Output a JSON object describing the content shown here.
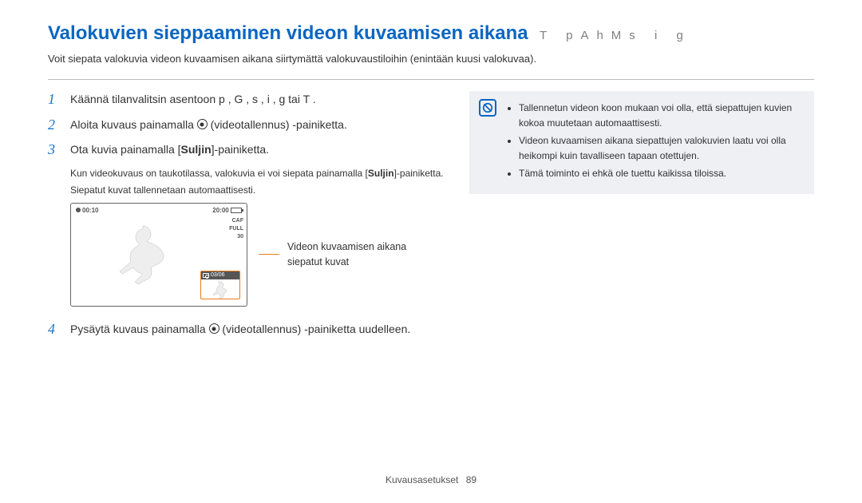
{
  "title": "Valokuvien sieppaaminen videon kuvaamisen aikana",
  "title_suffix": "T  pAhMs  i  g",
  "intro": "Voit siepata valokuvia videon kuvaamisen aikana siirtymättä valokuvaustiloihin (enintään kuusi valokuvaa).",
  "steps": {
    "s1": {
      "num": "1",
      "pre": "Käännä tilanvalitsin asentoon ",
      "modes": "p ,  G       ,  s    ,  i    ,  g    tai T",
      "post": "       ."
    },
    "s2": {
      "num": "2",
      "pre": "Aloita kuvaus painamalla ",
      "post": " (videotallennus) -painiketta."
    },
    "s3": {
      "num": "3",
      "pre": "Ota kuvia painamalla [",
      "btn": "Suljin",
      "post": "]-painiketta.",
      "note1_a": "Kun videokuvaus on taukotilassa, valokuvia ei voi siepata painamalla [",
      "note1_b": "Suljin",
      "note1_c": "]-painiketta.",
      "note2": "Siepatut kuvat tallennetaan automaattisesti."
    },
    "s4": {
      "num": "4",
      "pre": "Pysäytä kuvaus painamalla ",
      "post": " (videotallennus) -painiketta uudelleen."
    }
  },
  "shot": {
    "rec_time": "00:10",
    "remain": "20:00",
    "caf": "CAF",
    "full": "FULL",
    "fps": "30",
    "thumb_count": "03/06",
    "caption": "Videon kuvaamisen aikana siepatut kuvat"
  },
  "note_box": {
    "li1": "Tallennetun videon koon mukaan voi olla, että siepattujen kuvien kokoa muutetaan automaattisesti.",
    "li2": "Videon kuvaamisen aikana siepattujen valokuvien laatu voi olla heikompi kuin tavalliseen tapaan otettujen.",
    "li3": "Tämä toiminto ei ehkä ole tuettu kaikissa tiloissa."
  },
  "footer": {
    "section": "Kuvausasetukset",
    "page": "89"
  }
}
